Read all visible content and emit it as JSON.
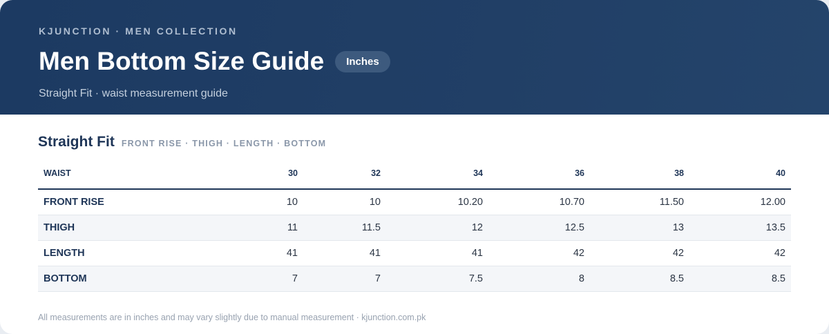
{
  "header": {
    "eyebrow": "KJUNCTION · MEN COLLECTION",
    "title": "Men Bottom Size Guide",
    "unit_badge": "Inches",
    "subtitle": "Straight Fit · waist measurement guide"
  },
  "section": {
    "title": "Straight Fit",
    "subtitle": "FRONT RISE · THIGH · LENGTH · BOTTOM"
  },
  "table": {
    "header_label": "WAIST",
    "sizes": [
      "30",
      "32",
      "34",
      "36",
      "38",
      "40"
    ],
    "rows": [
      {
        "label": "FRONT RISE",
        "values": [
          "10",
          "10",
          "10.20",
          "10.70",
          "11.50",
          "12.00"
        ]
      },
      {
        "label": "THIGH",
        "values": [
          "11",
          "11.5",
          "12",
          "12.5",
          "13",
          "13.5"
        ]
      },
      {
        "label": "LENGTH",
        "values": [
          "41",
          "41",
          "41",
          "42",
          "42",
          "42"
        ]
      },
      {
        "label": "BOTTOM",
        "values": [
          "7",
          "7",
          "7.5",
          "8",
          "8.5",
          "8.5"
        ]
      }
    ]
  },
  "footnote": "All measurements are in inches and may vary slightly due to manual measurement · kjunction.com.pk",
  "colors": {
    "header_bg": "#1c3a62",
    "accent_text": "#1e3557",
    "alt_row": "#f4f6f9"
  }
}
